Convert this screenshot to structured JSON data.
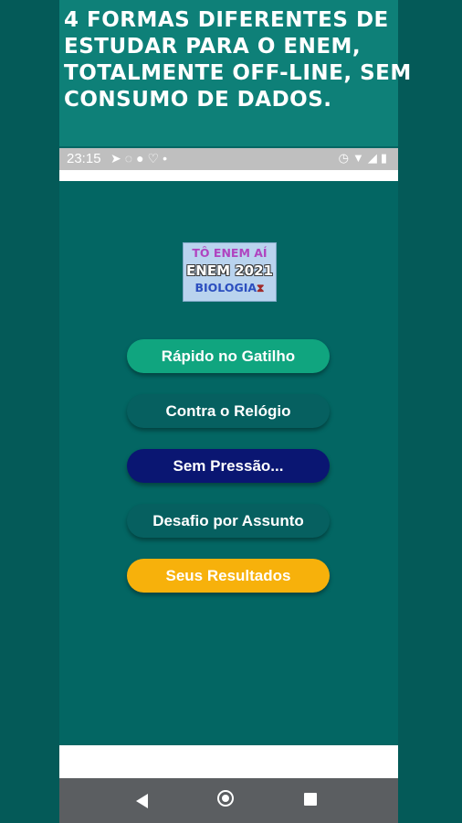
{
  "promo": {
    "headline": "4 FORMAS DIFERENTES DE\nESTUDAR PARA O ENEM,\nTOTALMENTE OFF-LINE, SEM\nCONSUMO DE DADOS."
  },
  "statusbar": {
    "time": "23:15",
    "left_icons": [
      "telegram-icon",
      "whatsapp-icon",
      "circle-icon",
      "heart-icon",
      "dot-icon"
    ],
    "right_icons": [
      "alarm-icon",
      "wifi-icon",
      "signal-icon",
      "battery-icon"
    ]
  },
  "logo": {
    "line1": "TÔ ENEM AÍ",
    "line2": "ENEM 2021",
    "line3": "BIOLOGIA",
    "icon": "hourglass-icon"
  },
  "menu": {
    "buttons": [
      {
        "label": "Rápido no Gatilho",
        "color": "#10a57f"
      },
      {
        "label": "Contra o Relógio",
        "color": "#066060"
      },
      {
        "label": "Sem Pressão...",
        "color": "#0a1672"
      },
      {
        "label": "Desafio por Assunto",
        "color": "#066060"
      },
      {
        "label": "Seus Resultados",
        "color": "#f7b10b"
      }
    ]
  },
  "navbar": {
    "icons": [
      "back-icon",
      "home-icon",
      "recents-icon"
    ]
  }
}
